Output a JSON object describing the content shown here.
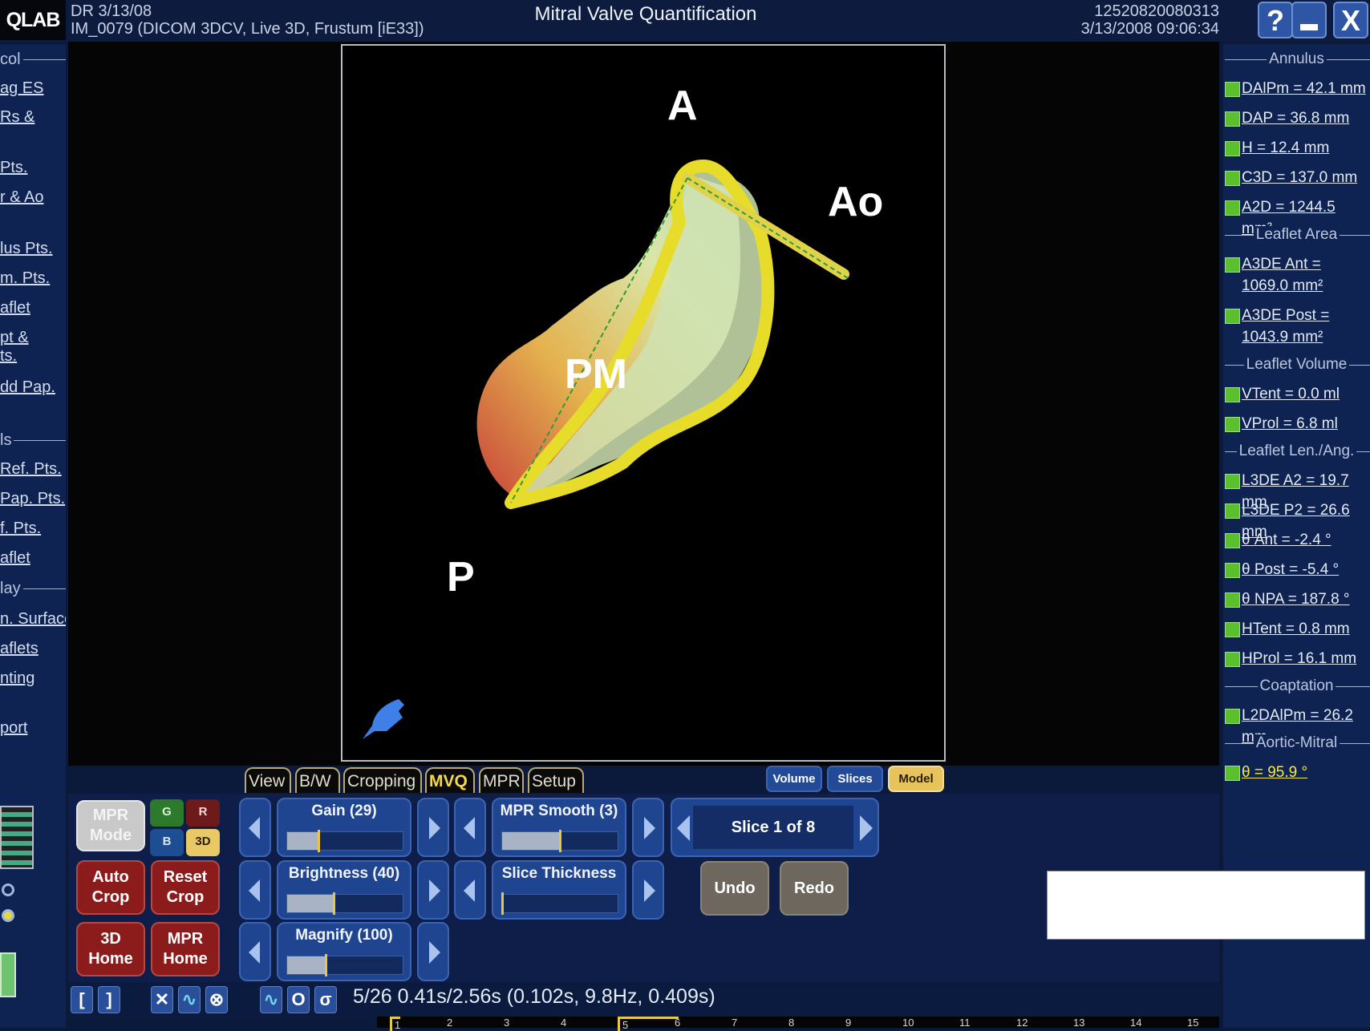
{
  "app": {
    "logo": "QLAB",
    "study_line1": "DR 3/13/08",
    "study_line2": "IM_0079 (DICOM 3DCV, Live 3D, Frustum [iE33])",
    "title": "Mitral Valve Quantification",
    "id_line1": "12520820080313",
    "id_line2": "3/13/2008 09:06:34",
    "window_buttons": [
      {
        "label": "?",
        "icon": "help-icon"
      },
      {
        "label": "_",
        "icon": "minimize-icon"
      },
      {
        "label": "X",
        "icon": "close-icon"
      }
    ]
  },
  "left_panel": {
    "items": [
      {
        "type": "header",
        "label": "col"
      },
      {
        "type": "item",
        "label": "ag ES"
      },
      {
        "type": "item",
        "label": "Rs &"
      },
      {
        "type": "item",
        "label": "Pts."
      },
      {
        "type": "item",
        "label": "r & Ao"
      },
      {
        "type": "item",
        "label": "lus Pts."
      },
      {
        "type": "item",
        "label": "m. Pts."
      },
      {
        "type": "item",
        "label": "aflet"
      },
      {
        "type": "item",
        "label": "pt &"
      },
      {
        "type": "item",
        "label": "ts."
      },
      {
        "type": "item",
        "label": "dd Pap."
      },
      {
        "type": "header",
        "label": "ls"
      },
      {
        "type": "item",
        "label": "Ref. Pts."
      },
      {
        "type": "item",
        "label": "Pap. Pts."
      },
      {
        "type": "item",
        "label": "f. Pts."
      },
      {
        "type": "item",
        "label": "aflet"
      },
      {
        "type": "header",
        "label": "lay"
      },
      {
        "type": "item",
        "label": "n. Surface"
      },
      {
        "type": "item",
        "label": "aflets"
      },
      {
        "type": "item",
        "label": "nting"
      },
      {
        "type": "item",
        "label": "port"
      }
    ]
  },
  "viewport": {
    "labels": {
      "anterior": "A",
      "aorta": "Ao",
      "posteromedial": "PM",
      "posterior": "P"
    },
    "orientation_icon": "heart-orientation-icon"
  },
  "tabs": [
    {
      "label": "View",
      "active": false
    },
    {
      "label": "B/W",
      "active": false
    },
    {
      "label": "Cropping",
      "active": false
    },
    {
      "label": "MVQ",
      "active": true
    },
    {
      "label": "MPR",
      "active": false
    },
    {
      "label": "Setup",
      "active": false
    }
  ],
  "view_modes": [
    {
      "label": "Volume",
      "active": false
    },
    {
      "label": "Slices",
      "active": false
    },
    {
      "label": "Model",
      "active": true
    }
  ],
  "controls": {
    "mpr_mode": "MPR\nMode",
    "color_buttons": [
      "G",
      "R",
      "B",
      "3D"
    ],
    "auto_crop": "Auto\nCrop",
    "reset_crop": "Reset\nCrop",
    "home_3d": "3D\nHome",
    "home_mpr": "MPR\nHome",
    "sliders": [
      {
        "label": "Gain (29)",
        "fraction": 0.27
      },
      {
        "label": "MPR Smooth (3)",
        "fraction": 0.5
      },
      {
        "label": "Brightness (40)",
        "fraction": 0.4
      },
      {
        "label": "Slice Thickness",
        "fraction": 0.0
      },
      {
        "label": "Magnify (100)",
        "fraction": 0.33
      }
    ],
    "slice_selector": "Slice 1 of 8",
    "undo": "Undo",
    "redo": "Redo"
  },
  "right_panel": {
    "sections": [
      {
        "header": "Annulus",
        "items": [
          "DAlPm = 42.1 mm",
          "DAP = 36.8 mm",
          "H = 12.4 mm",
          "C3D = 137.0 mm",
          "A2D = 1244.5 mm²"
        ]
      },
      {
        "header": "Leaflet Area",
        "items": [
          "A3DE Ant = 1069.0 mm²",
          "A3DE Post = 1043.9 mm²"
        ]
      },
      {
        "header": "Leaflet Volume",
        "items": [
          "VTent = 0.0 ml",
          "VProl = 6.8 ml"
        ]
      },
      {
        "header": "Leaflet Len./Ang.",
        "items": [
          "L3DE A2 = 19.7 mm",
          "L3DE P2 = 26.6 mm",
          "θ Ant = -2.4 °",
          "θ Post = -5.4 °",
          "θ NPA = 187.8 °",
          "HTent = 0.8 mm",
          "HProl = 16.1 mm"
        ]
      },
      {
        "header": "Coaptation",
        "items": [
          "L2DAlPm = 26.2 mm"
        ]
      },
      {
        "header": "Aortic-Mitral",
        "items": [
          "θ = 95.9 °"
        ]
      }
    ]
  },
  "bottom_bar": {
    "frame_info": "5/26  0.41s/2.56s (0.102s, 9.8Hz, 0.409s)",
    "timeline_ticks": [
      "1",
      "2",
      "3",
      "4",
      "5",
      "6",
      "7",
      "8",
      "9",
      "10",
      "11",
      "12",
      "13",
      "14",
      "15"
    ],
    "current_frame": "5"
  }
}
